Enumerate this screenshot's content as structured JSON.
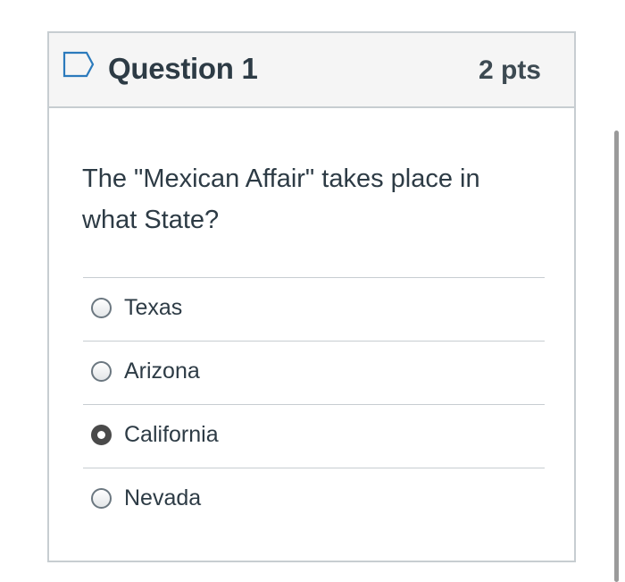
{
  "question": {
    "title": "Question 1",
    "points": "2 pts",
    "flag_icon": "flag-outline-icon",
    "text": "The \"Mexican Affair\" takes place in what State?"
  },
  "answers": [
    {
      "label": "Texas",
      "selected": false
    },
    {
      "label": "Arizona",
      "selected": false
    },
    {
      "label": "California",
      "selected": true
    },
    {
      "label": "Nevada",
      "selected": false
    }
  ],
  "colors": {
    "header_bg": "#f5f5f5",
    "border": "#c7cdd1",
    "text": "#2d3b45",
    "flag_icon": "#2b7abc",
    "radio_checked": "#4a4a4a"
  }
}
